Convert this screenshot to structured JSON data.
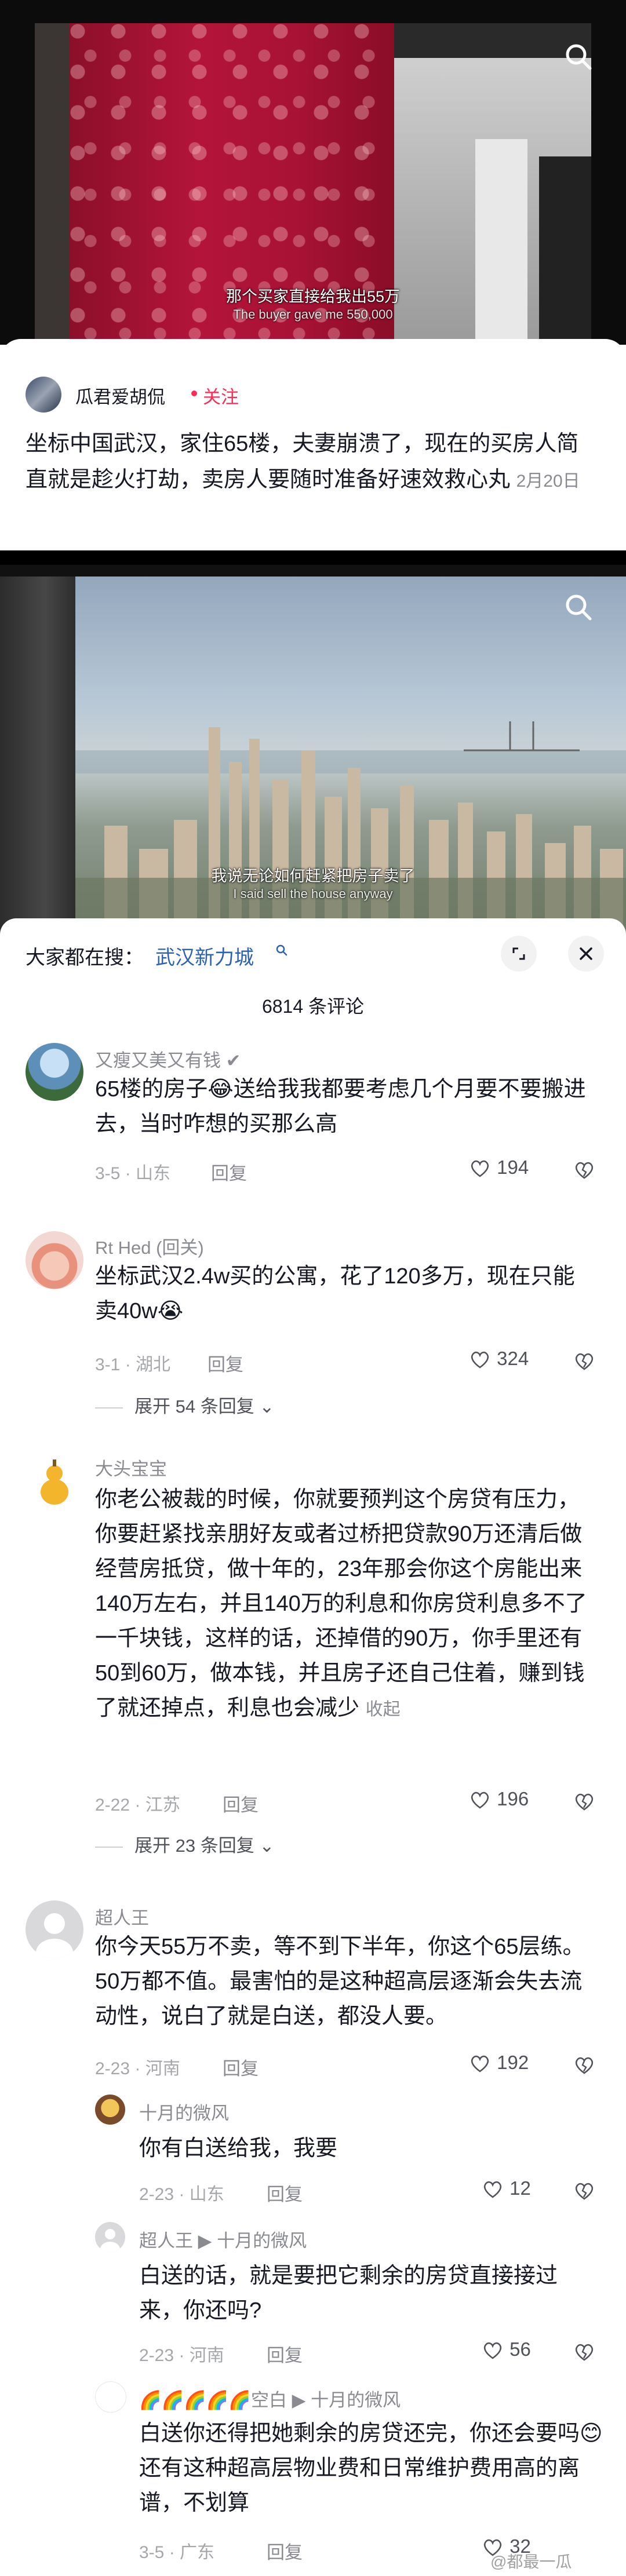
{
  "video1": {
    "subtitle_zh": "那个买家直接给我出55万",
    "subtitle_en": "The buyer gave me 550,000",
    "search_icon": "search-icon"
  },
  "post": {
    "author": "瓜君爱胡侃",
    "follow_label": "关注",
    "text": "坐标中国武汉，家住65楼，夫妻崩溃了，现在的买房人简直就是趁火打劫，卖房人要随时准备好速效救心丸",
    "date": "2月20日"
  },
  "video2": {
    "subtitle_zh": "我说无论如何赶紧把房子卖了",
    "subtitle_en": "I said sell the house anyway",
    "search_icon": "search-icon"
  },
  "comments_panel": {
    "search_hint_label": "大家都在搜：",
    "search_hint_link": "武汉新力城",
    "count_label": "6814 条评论",
    "reply_label": "回复",
    "comments": [
      {
        "name": "又瘦又美又有钱 ✔",
        "text": "65楼的房子😂送给我我都要考虑几个月要不要搬进去，当时咋想的买那么高",
        "date": "3-5",
        "location": "山东",
        "likes": "194"
      },
      {
        "name": "Rt Hed (回关)",
        "text": "坐标武汉2.4w买的公寓，花了120多万，现在只能卖40w😭",
        "date": "3-1",
        "location": "湖北",
        "likes": "324",
        "expand": "展开 54 条回复"
      },
      {
        "name": "大头宝宝",
        "text": "你老公被裁的时候，你就要预判这个房贷有压力，你要赶紧找亲朋好友或者过桥把贷款90万还清后做经营房抵贷，做十年的，23年那会你这个房能出来140万左右，并且140万的利息和你房贷利息多不了一千块钱，这样的话，还掉借的90万，你手里还有50到60万，做本钱，并且房子还自己住着，赚到钱了就还掉点，利息也会减少",
        "collapse": "收起",
        "date": "2-22",
        "location": "江苏",
        "likes": "196",
        "expand": "展开 23 条回复"
      },
      {
        "name": "超人王",
        "text": "你今天55万不卖，等不到下半年，你这个65层练。50万都不值。最害怕的是这种超高层逐渐会失去流动性，说白了就是白送，都没人要。",
        "date": "2-23",
        "location": "河南",
        "likes": "192"
      }
    ],
    "replies": [
      {
        "name": "十月的微风",
        "text": "你有白送给我，我要",
        "date": "2-23",
        "location": "山东",
        "likes": "12"
      },
      {
        "name": "超人王",
        "reply_to": "十月的微风",
        "text": "白送的话，就是要把它剩余的房贷直接接过来，你还吗?",
        "date": "2-23",
        "location": "河南",
        "likes": "56"
      },
      {
        "name": "🌈🌈🌈🌈🌈空白",
        "reply_to": "十月的微风",
        "text": "白送你还得把她剩余的房贷还完，你还会要吗😊还有这种超高层物业费和日常维护费用高的离谱，不划算",
        "date": "3-5",
        "location": "广东",
        "likes": "32"
      }
    ]
  },
  "watermark": "@都最一瓜",
  "colors": {
    "accent": "#fe2c55",
    "link": "#2c61b3",
    "muted": "#8a8b91"
  }
}
